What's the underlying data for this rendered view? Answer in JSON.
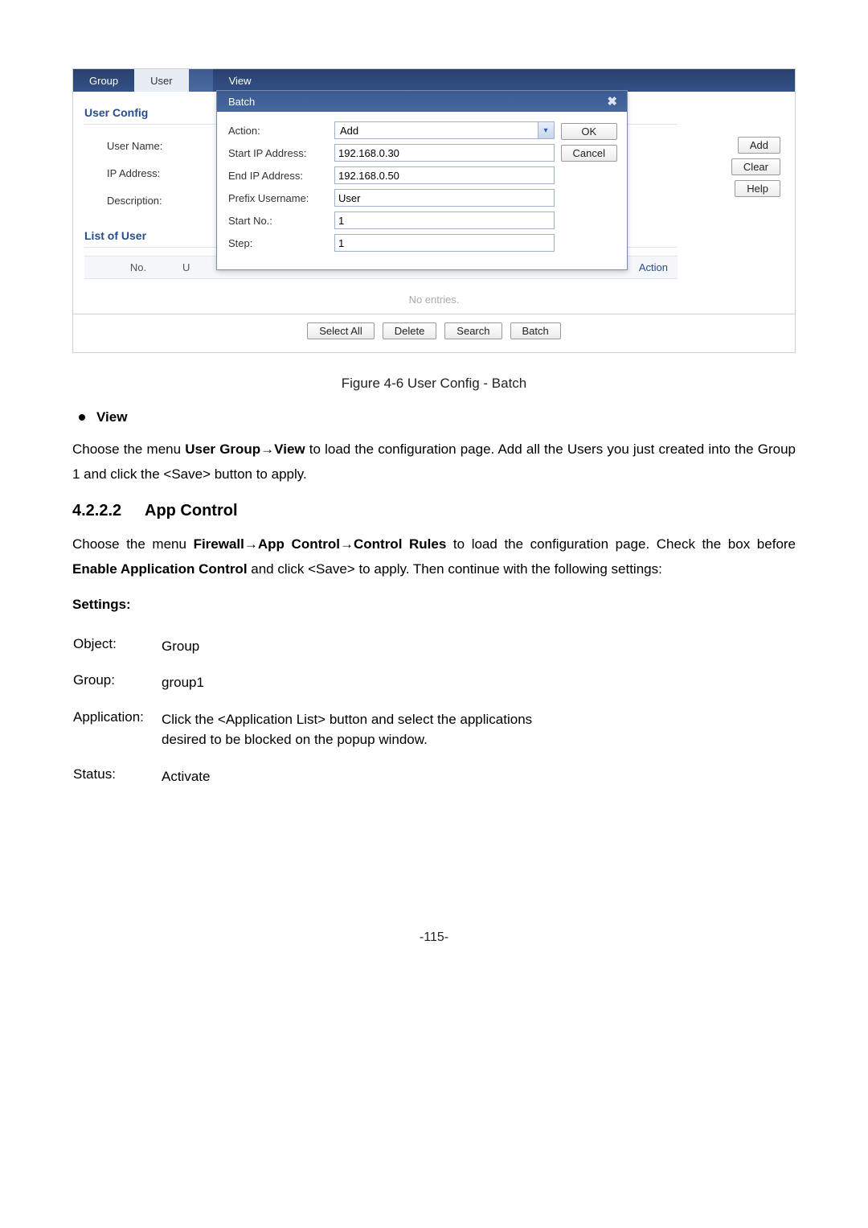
{
  "tabs": {
    "group": "Group",
    "user": "User",
    "view": "View"
  },
  "panel": {
    "section": "User Config",
    "labels": {
      "username": "User Name:",
      "ip": "IP Address:",
      "desc": "Description:"
    },
    "list_section": "List of User",
    "list_cols": {
      "no": "No.",
      "u": "U",
      "action": "Action"
    },
    "no_entries": "No entries.",
    "side_buttons": {
      "add": "Add",
      "clear": "Clear",
      "help": "Help"
    },
    "bottom_buttons": {
      "select_all": "Select All",
      "delete": "Delete",
      "search": "Search",
      "batch": "Batch"
    }
  },
  "modal": {
    "title": "Batch",
    "fields": {
      "action_lbl": "Action:",
      "action_val": "Add",
      "start_ip_lbl": "Start IP Address:",
      "start_ip_val": "192.168.0.30",
      "end_ip_lbl": "End IP Address:",
      "end_ip_val": "192.168.0.50",
      "prefix_lbl": "Prefix Username:",
      "prefix_val": "User",
      "startno_lbl": "Start No.:",
      "startno_val": "1",
      "step_lbl": "Step:",
      "step_val": "1"
    },
    "buttons": {
      "ok": "OK",
      "cancel": "Cancel"
    }
  },
  "doc": {
    "figcaption": "Figure 4-6 User Config - Batch",
    "bullet_view": "View",
    "view_p_before": "Choose the menu ",
    "view_p_bold": "User Group→View",
    "view_p_after": " to load the configuration page. Add all the Users you just created into the Group 1 and click the <Save> button to apply.",
    "heading_num": "4.2.2.2",
    "heading_txt": "App Control",
    "appc_p1": "Choose the menu ",
    "appc_b1": "Firewall",
    "appc_b2": "App Control",
    "appc_b3": "Control Rules",
    "appc_mid1": " to load the configuration page. Check the box before ",
    "appc_b4": "Enable Application Control",
    "appc_end": " and click <Save> to apply. Then continue with the following settings:",
    "settings": "Settings:",
    "rows": {
      "object_l": "Object:",
      "object_v": "Group",
      "group_l": "Group:",
      "group_v": "group1",
      "app_l": "Application:",
      "app_v": "Click the <Application List> button and select the applications desired to be blocked on the popup window.",
      "status_l": "Status:",
      "status_v": "Activate"
    },
    "pageno": "-115-"
  }
}
